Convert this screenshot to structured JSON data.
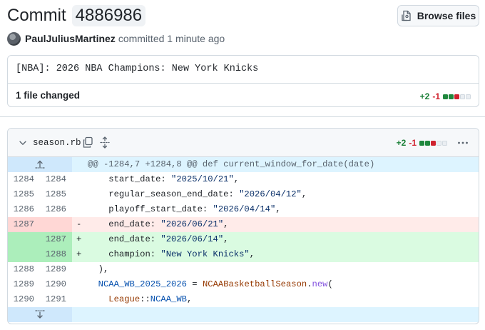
{
  "commit": {
    "title_word": "Commit",
    "sha": "4886986",
    "browse_label": "Browse files",
    "author": "PaulJuliusMartinez",
    "committed_text": "committed 1 minute ago",
    "message": "[NBA]: 2026 NBA Champions: New York Knicks",
    "files_changed": "1 file changed",
    "additions": "+2",
    "deletions": "-1"
  },
  "diff": {
    "filename": "season.rb",
    "additions": "+2",
    "deletions": "-1",
    "hunk_header": "@@ -1284,7 +1284,8 @@ def current_window_for_date(date)",
    "lines": [
      {
        "old": "1284",
        "new": "1284",
        "type": "ctx",
        "marker": "",
        "code": "    start_date: \"2025/10/21\","
      },
      {
        "old": "1285",
        "new": "1285",
        "type": "ctx",
        "marker": "",
        "code": "    regular_season_end_date: \"2026/04/12\","
      },
      {
        "old": "1286",
        "new": "1286",
        "type": "ctx",
        "marker": "",
        "code": "    playoff_start_date: \"2026/04/14\","
      },
      {
        "old": "1287",
        "new": "",
        "type": "del",
        "marker": "-",
        "code": "    end_date: \"2026/06/21\","
      },
      {
        "old": "",
        "new": "1287",
        "type": "add",
        "marker": "+",
        "code": "    end_date: \"2026/06/14\","
      },
      {
        "old": "",
        "new": "1288",
        "type": "add",
        "marker": "+",
        "code": "    champion: \"New York Knicks\","
      },
      {
        "old": "1288",
        "new": "1289",
        "type": "ctx",
        "marker": "",
        "code": "  ),"
      },
      {
        "old": "1289",
        "new": "1290",
        "type": "ctx",
        "marker": "",
        "code": "  NCAA_WB_2025_2026 = NCAABasketballSeason.new("
      },
      {
        "old": "1290",
        "new": "1291",
        "type": "ctx",
        "marker": "",
        "code": "    League::NCAA_WB,"
      }
    ]
  },
  "colors": {
    "addition": "#1a7f37",
    "deletion": "#d1242f",
    "hunk_bg": "#ddf4ff"
  },
  "icons": [
    "file-diff-icon",
    "chevron-down-icon",
    "copy-icon",
    "expand-all-icon",
    "kebab-icon",
    "expand-up-icon",
    "expand-down-icon"
  ]
}
